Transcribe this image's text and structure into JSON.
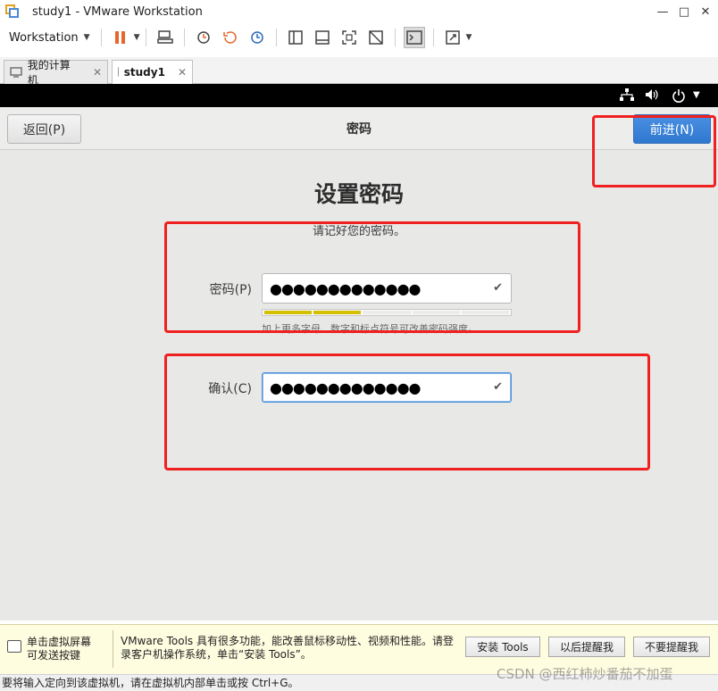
{
  "window": {
    "title": "study1 - VMware Workstation",
    "min": "—",
    "max": "□",
    "close": "✕"
  },
  "toolbar": {
    "workstation_label": "Workstation"
  },
  "tabs": [
    {
      "label": "我的计算机",
      "close": "✕"
    },
    {
      "label": "study1",
      "close": "✕"
    }
  ],
  "vm_header": {
    "back_label": "返回(P)",
    "title": "密码",
    "next_label": "前进(N)"
  },
  "setup": {
    "heading": "设置密码",
    "subtitle": "请记好您的密码。",
    "password_label": "密码(P)",
    "password_value": "●●●●●●●●●●●●●",
    "confirm_label": "确认(C)",
    "confirm_value": "●●●●●●●●●●●●●",
    "strength_hint": "加上更多字母、数字和标点符号可改善密码强度。",
    "strength_level": 0.4
  },
  "notification": {
    "left_text_line1": "单击虚拟屏幕",
    "left_text_line2": "可发送按键",
    "message": "VMware Tools 具有很多功能，能改善鼠标移动性、视频和性能。请登录客户机操作系统，单击“安装 Tools”。",
    "install_btn": "安装 Tools",
    "later_btn": "以后提醒我",
    "never_btn": "不要提醒我"
  },
  "statusbar": {
    "text": "要将输入定向到该虚拟机，请在虚拟机内部单击或按 Ctrl+G。"
  },
  "watermark": "CSDN @西红柿炒番茄不加蛋",
  "colors": {
    "accent": "#2f78d0",
    "highlight": "#f02020",
    "strength": "#d4c000"
  }
}
